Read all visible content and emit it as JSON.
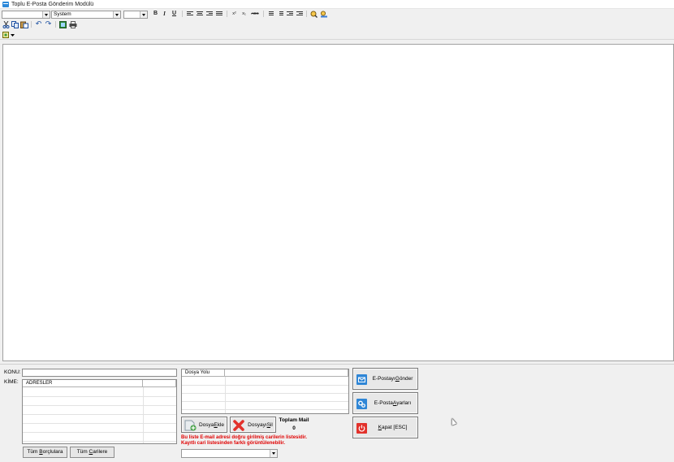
{
  "window": {
    "title": "Toplu E-Posta Gönderim Modülü"
  },
  "toolbar": {
    "font_name": "",
    "font_face": "System",
    "font_size": "",
    "bold": "B",
    "italic": "I",
    "underline": "U",
    "superscript": "x²",
    "subscript": "x₁",
    "strike": "ABC"
  },
  "form": {
    "subject_label": "KONU:",
    "to_label": "KİME:",
    "subject_value": "",
    "addresses_header": "ADRESLER",
    "attach_header": "Dosya Yolu",
    "all_debtors_prefix": "Tüm ",
    "all_debtors_key": "B",
    "all_debtors_rest": "orçlulara",
    "all_accounts_prefix": "Tüm ",
    "all_accounts_key": "C",
    "all_accounts_rest": "arilere",
    "add_file_prefix": "Dosya ",
    "add_file_key": "E",
    "add_file_rest": "kle",
    "delete_file_prefix": "Dosyayı ",
    "delete_file_key": "S",
    "delete_file_rest": "il",
    "total_label": "Toplam Mail",
    "total_value": "0",
    "warning_line1": "Bu liste E-mail adresi doğru girilmiş carilerin listesidir.",
    "warning_line2": "Kayıtlı cari listesinden farklı görüntülenebilir.",
    "filter_value": ""
  },
  "actions": {
    "send_prefix": "E-Postayı ",
    "send_key": "G",
    "send_rest": "önder",
    "settings_prefix": "E-Posta ",
    "settings_key": "A",
    "settings_rest": "yarları",
    "close_key": "K",
    "close_rest": "apat [ESC]"
  },
  "colors": {
    "send_icon": "#2f86d6",
    "settings_icon": "#2f86d6",
    "close_icon": "#e2312b",
    "warning": "#e00000"
  }
}
